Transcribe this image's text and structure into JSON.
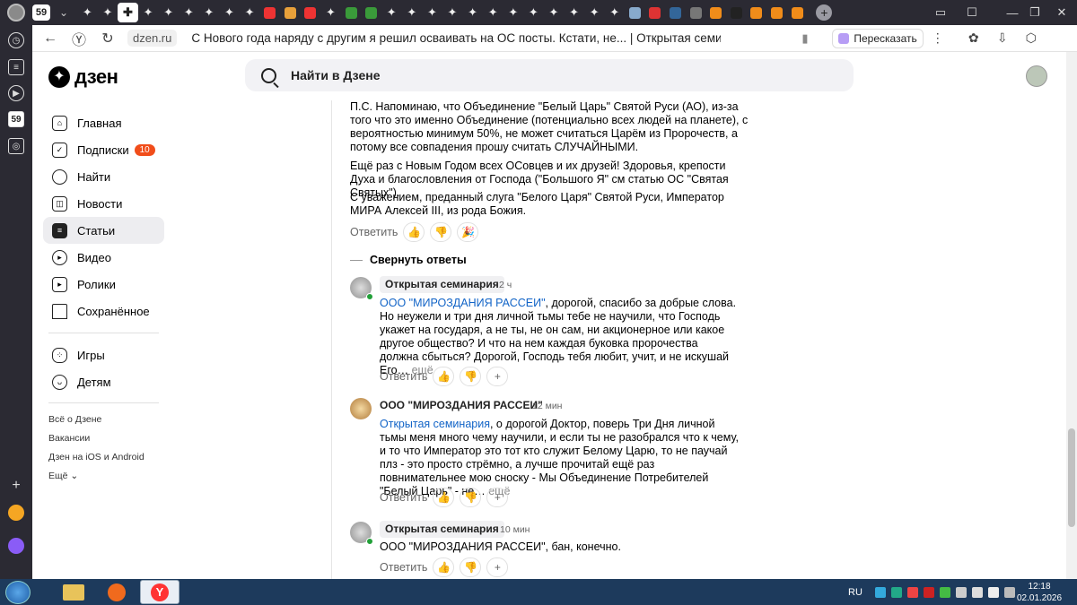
{
  "browser": {
    "tab_counter": "59",
    "url_domain": "dzen.ru",
    "page_title": "С Нового года наряду с другим я решил осваивать на ОС посты. Кстати, не... | Открытая семинария | Дзен",
    "retell_label": "Пересказать"
  },
  "header": {
    "logo": "дзен",
    "search_placeholder": "Найти в Дзене"
  },
  "sidebar": {
    "items": [
      {
        "label": "Главная",
        "icon": "home-icon"
      },
      {
        "label": "Подписки",
        "icon": "subscriptions-icon",
        "badge": "10"
      },
      {
        "label": "Найти",
        "icon": "search-icon"
      },
      {
        "label": "Новости",
        "icon": "news-icon"
      },
      {
        "label": "Статьи",
        "icon": "articles-icon"
      },
      {
        "label": "Видео",
        "icon": "video-icon"
      },
      {
        "label": "Ролики",
        "icon": "shorts-icon"
      },
      {
        "label": "Сохранённое",
        "icon": "bookmark-icon"
      },
      {
        "label": "Игры",
        "icon": "gamepad-icon"
      },
      {
        "label": "Детям",
        "icon": "kids-icon"
      }
    ],
    "links": [
      "Всё о Дзене",
      "Вакансии",
      "Дзен на iOS и Android",
      "Ещё"
    ]
  },
  "post": {
    "paragraphs": [
      "П.С. Напоминаю, что Объединение \"Белый Царь\" Святой Руси (АО), из-за того что это именно Объединение (потенциально всех людей на планете), с вероятностью минимум 50%, не может считаться Царём из Пророчеств, а потому все совпадения прошу считать СЛУЧАЙНЫМИ.",
      "Ещё раз с Новым Годом всех ОСовцев и их друзей! Здоровья, крепости Духа и благословления от Господа (\"Большого Я\" см статью ОС \"Святая Святых\").",
      "С уважением, преданный слуга \"Белого Царя\" Святой Руси, Император МИРА Алексей III, из рода Божия."
    ],
    "reply_label": "Ответить",
    "collapse_label": "Свернуть ответы"
  },
  "comments": [
    {
      "author": "Открытая семинария",
      "time": "2 ч",
      "mention": "ООО \"МИРОЗДАНИЯ РАССЕИ\"",
      "text": ", дорогой, спасибо за добрые слова. Но неужели и три дня личной тьмы тебе не научили, что Господь укажет на государя, а не ты, не он сам, ни акционерное или какое другое общество? И что на нем каждая буковка пророчества должна сбыться? Дорогой, Господь тебя любит, учит, и не искушай Его…",
      "more": "ещё"
    },
    {
      "author": "ООО \"МИРОЗДАНИЯ РАССЕИ\"",
      "time": "12 мин",
      "mention": "Открытая семинария",
      "text": ", о дорогой Доктор, поверь Три Дня личной тьмы меня много чему научили, и если ты не разобрался что к чему, и то что Император это тот кто служит Белому Царю, то не паучай плз - это просто стрёмно, а лучше прочитай ещё раз повнимательнее мою сноску - Мы Объединение Потребителей \"Белый Царь\" - не…",
      "more": "ещё"
    },
    {
      "author": "Открытая семинария",
      "time": "10 мин",
      "mention": "",
      "text": "ООО \"МИРОЗДАНИЯ РАССЕИ\", бан, конечно.",
      "more": ""
    }
  ],
  "taskbar": {
    "lang": "RU",
    "time": "12:18",
    "date": "02.01.2026"
  }
}
